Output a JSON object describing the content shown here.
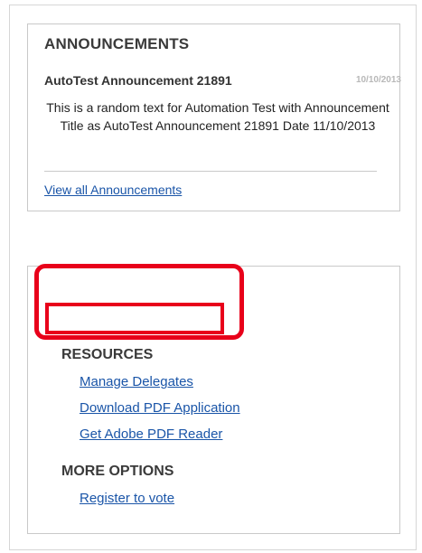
{
  "announcements": {
    "heading": "ANNOUNCEMENTS",
    "item": {
      "title": "AutoTest Announcement 21891",
      "date": "10/10/2013",
      "body": "This is a random text for Automation Test with Announcement Title as AutoTest Announcement 21891 Date 11/10/2013"
    },
    "view_all_label": "View all Announcements"
  },
  "resources": {
    "heading": "RESOURCES",
    "links": [
      "Manage Delegates",
      "Download PDF Application",
      "Get Adobe PDF Reader"
    ]
  },
  "more_options": {
    "heading": "MORE OPTIONS",
    "links": [
      "Register to vote"
    ]
  },
  "colors": {
    "link": "#1a55a8",
    "highlight": "#e8001a",
    "date": "#b8b8b8",
    "border": "#c9c9c9"
  }
}
